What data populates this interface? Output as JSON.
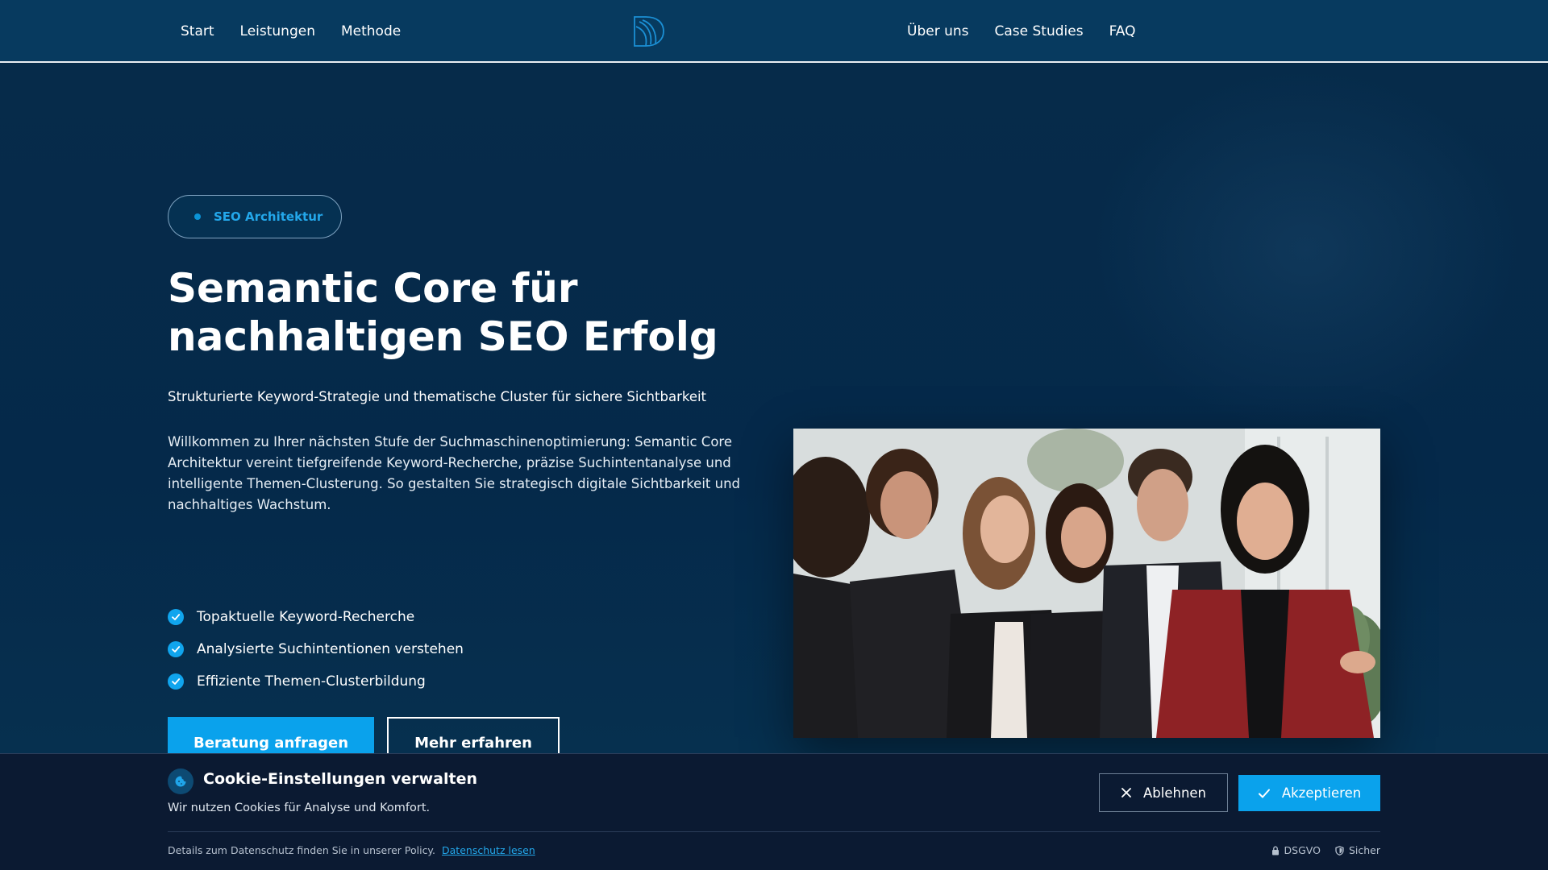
{
  "header": {
    "nav_left": [
      "Start",
      "Leistungen",
      "Methode"
    ],
    "nav_right": [
      "Über uns",
      "Case Studies",
      "FAQ"
    ],
    "logo_icon": "logo-mark-icon"
  },
  "hero": {
    "badge": "SEO Architektur",
    "title_line1": "Semantic Core für",
    "title_line2": "nachhaltigen SEO Erfolg",
    "subtitle": "Strukturierte Keyword-Strategie und thematische Cluster für sichere Sichtbarkeit",
    "intro": "Willkommen zu Ihrer nächsten Stufe der Suchmaschinenoptimierung: Semantic Core Architektur vereint tiefgreifende Keyword-Recherche, präzise Suchintentanalyse und intelligente Themen-Clusterung. So gestalten Sie strategisch digitale Sichtbarkeit und nachhaltiges Wachstum.",
    "features": [
      "Topaktuelle Keyword-Recherche",
      "Analysierte Suchintentionen verstehen",
      "Effiziente Themen-Clusterbildung"
    ],
    "primary_cta": "Beratung anfragen",
    "secondary_cta": "Mehr erfahren",
    "image_icon": "team-photo"
  },
  "cookie": {
    "title": "Cookie-Einstellungen verwalten",
    "text": "Wir nutzen Cookies für Analyse und Komfort.",
    "decline": "Ablehnen",
    "accept": "Akzeptieren",
    "footer_text": "Details zum Datenschutz finden Sie in unserer Policy.",
    "footer_link": "Datenschutz lesen",
    "tag_gdpr": "DSGVO",
    "tag_secure": "Sicher"
  },
  "colors": {
    "background": "#052a48",
    "header": "#073a5f",
    "accent": "#0aa2ec",
    "cookie_bg": "#0b1a32"
  }
}
